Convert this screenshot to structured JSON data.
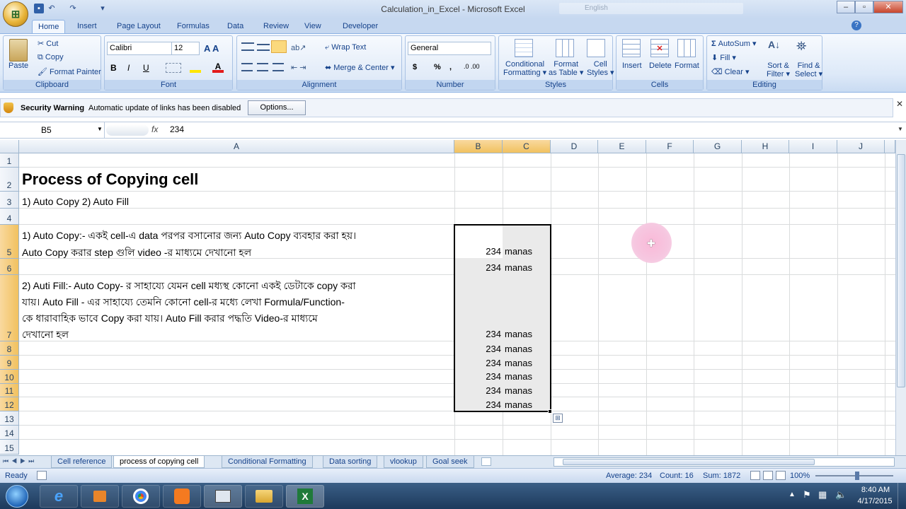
{
  "window": {
    "title": "Calculation_in_Excel - Microsoft Excel",
    "search_placeholder": "English"
  },
  "ribbon": {
    "tabs": [
      "Home",
      "Insert",
      "Page Layout",
      "Formulas",
      "Data",
      "Review",
      "View",
      "Developer"
    ],
    "active_tab": "Home",
    "clipboard": {
      "paste": "Paste",
      "cut": "Cut",
      "copy": "Copy",
      "format_painter": "Format Painter",
      "label": "Clipboard"
    },
    "font": {
      "name": "Calibri",
      "size": "12",
      "label": "Font",
      "bold": "B",
      "italic": "I",
      "underline": "U"
    },
    "alignment": {
      "wrap_text": "Wrap Text",
      "merge_center": "Merge & Center",
      "label": "Alignment"
    },
    "number": {
      "format": "General",
      "label": "Number",
      "currency": "$",
      "percent": "%",
      "comma": ","
    },
    "styles": {
      "conditional": "Conditional",
      "formatting": "Formatting",
      "format_as": "Format",
      "as_table": "as Table",
      "cell": "Cell",
      "cell_styles": "Styles",
      "label": "Styles"
    },
    "cells": {
      "insert": "Insert",
      "delete": "Delete",
      "format": "Format",
      "label": "Cells"
    },
    "editing": {
      "autosum": "AutoSum",
      "fill": "Fill",
      "clear": "Clear",
      "sort": "Sort &",
      "filter": "Filter",
      "find": "Find &",
      "select": "Select",
      "label": "Editing"
    }
  },
  "security": {
    "title": "Security Warning",
    "message": "Automatic update of links has been disabled",
    "button": "Options..."
  },
  "formula_bar": {
    "name_box": "B5",
    "fx": "fx",
    "value": "234"
  },
  "columns": [
    "A",
    "B",
    "C",
    "D",
    "E",
    "F",
    "G",
    "H",
    "I",
    "J"
  ],
  "rows": [
    "1",
    "2",
    "3",
    "4",
    "5",
    "6",
    "7",
    "8",
    "9",
    "10",
    "11",
    "12",
    "13",
    "14",
    "15"
  ],
  "cells": {
    "a2": "Process of Copying cell",
    "a3": "1) Auto Copy 2) Auto Fill",
    "a5_line1": "1) Auto Copy:- একই  cell-এ  data পরপর  বসানোর  জন্য  Auto Copy ব্যবহার  করা  হয়।",
    "a5_line2": "Auto Copy  করার  step গুলি    video -র  মাধ্যমে  দেখানো  হল",
    "a7_line1": "2) Auti Fill:- Auto Copy- র  সাহায্যে  যেমন  cell মধ্যস্থ  কোনো  একই  ডেটাকে  copy করা",
    "a7_line2": "যায়।  Auto Fill - এর  সাহায্যে  তেমনি  কোনো  cell-র  মধ্যে  লেখা  Formula/Function-",
    "a7_line3": "কে  ধারাবাহিক  ভাবে  Copy  করা  যায়।  Auto Fill করার  পদ্ধতি  Video-র  মাধ্যমে",
    "a7_line4": "দেখানো  হল",
    "data_rows": [
      {
        "row": "5",
        "b": "234",
        "c": "manas"
      },
      {
        "row": "6",
        "b": "234",
        "c": "manas"
      },
      {
        "row": "7",
        "b": "234",
        "c": "manas"
      },
      {
        "row": "8",
        "b": "234",
        "c": "manas"
      },
      {
        "row": "9",
        "b": "234",
        "c": "manas"
      },
      {
        "row": "10",
        "b": "234",
        "c": "manas"
      },
      {
        "row": "11",
        "b": "234",
        "c": "manas"
      },
      {
        "row": "12",
        "b": "234",
        "c": "manas"
      }
    ]
  },
  "sheet_tabs": [
    "Cell reference",
    "process of copying cell",
    "Conditional Formatting",
    "Data sorting",
    "vlookup",
    "Goal seek"
  ],
  "active_sheet": "process of copying cell",
  "status": {
    "ready": "Ready",
    "average": "Average: 234",
    "count": "Count: 16",
    "sum": "Sum: 1872",
    "zoom": "100%"
  },
  "taskbar": {
    "time": "8:40 AM",
    "date": "4/17/2015"
  },
  "colors": {
    "selection_header": "#f1c15f",
    "ribbon": "#dbe7f6",
    "taskbar": "#1d3a5c",
    "cursor_highlight": "#f6c7e0"
  }
}
